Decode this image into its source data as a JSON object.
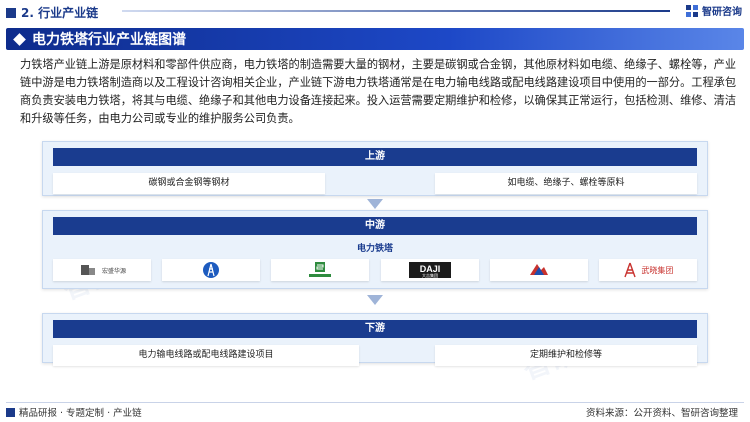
{
  "header": {
    "section_label": "2. 行业产业链",
    "brand_name": "智研咨询"
  },
  "banner": {
    "title": "电力铁塔行业产业链图谱"
  },
  "description": "力铁塔产业链上游是原材料和零部件供应商，电力铁塔的制造需要大量的钢材，主要是碳钢或合金钢，其他原材料如电缆、绝缘子、螺栓等，产业链中游是电力铁塔制造商以及工程设计咨询相关企业，产业链下游电力铁塔通常是在电力输电线路或配电线路建设项目中使用的一部分。工程承包商负责安装电力铁塔，将其与电缆、绝缘子和其他电力设备连接起来。投入运营需要定期维护和检修，以确保其正常运行，包括检测、维修、清洁和升级等任务，由电力公司或专业的维护服务公司负责。",
  "upstream": {
    "title": "上游",
    "items": [
      "碳钢或合金钢等钢材",
      "如电缆、绝缘子、螺栓等原料"
    ]
  },
  "midstream": {
    "title": "中游",
    "subtitle": "电力铁塔",
    "companies": [
      {
        "name": "宏盛华源",
        "icon": "hongsheng-logo"
      },
      {
        "name": "",
        "icon": "tower-logo"
      },
      {
        "name": "",
        "icon": "green-s-logo"
      },
      {
        "name": "DAJI 大吉集团",
        "icon": "daji-logo"
      },
      {
        "name": "",
        "icon": "mountain-logo"
      },
      {
        "name": "武晓集团",
        "icon": "wuxiao-logo"
      }
    ]
  },
  "downstream": {
    "title": "下游",
    "items": [
      "电力输电线路或配电线路建设项目",
      "定期维护和检修等"
    ]
  },
  "footer": {
    "left": "精品研报 · 专题定制 · 产业链",
    "right": "资料来源：公开资料、智研咨询整理"
  },
  "colors": {
    "primary": "#1a3c8f",
    "panel_bg": "#eaf2fb"
  }
}
